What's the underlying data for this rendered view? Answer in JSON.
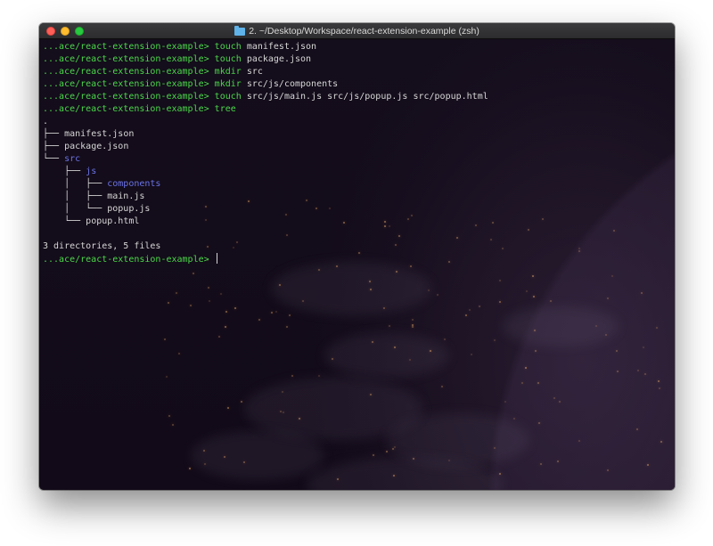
{
  "window": {
    "title": "2. ~/Desktop/Workspace/react-extension-example (zsh)",
    "title_icon": "folder-icon",
    "traffic_lights": {
      "close_color": "#fe5f57",
      "minimize_color": "#febc2e",
      "zoom_color": "#28c840"
    }
  },
  "terminal": {
    "colors": {
      "prompt": "#4bd84b",
      "directory": "#6b73e6",
      "text": "#d7d7d7"
    },
    "history": [
      {
        "prompt": "...ace/react-extension-example>",
        "command": "touch",
        "args": "manifest.json"
      },
      {
        "prompt": "...ace/react-extension-example>",
        "command": "touch",
        "args": "package.json"
      },
      {
        "prompt": "...ace/react-extension-example>",
        "command": "mkdir",
        "args": "src"
      },
      {
        "prompt": "...ace/react-extension-example>",
        "command": "mkdir",
        "args": "src/js/components"
      },
      {
        "prompt": "...ace/react-extension-example>",
        "command": "touch",
        "args": "src/js/main.js src/js/popup.js src/popup.html"
      },
      {
        "prompt": "...ace/react-extension-example>",
        "command": "tree",
        "args": ""
      }
    ],
    "tree_output": [
      {
        "branch": ".",
        "name": "",
        "is_dir": false
      },
      {
        "branch": "├── ",
        "name": "manifest.json",
        "is_dir": false
      },
      {
        "branch": "├── ",
        "name": "package.json",
        "is_dir": false
      },
      {
        "branch": "└── ",
        "name": "src",
        "is_dir": true
      },
      {
        "branch": "    ├── ",
        "name": "js",
        "is_dir": true
      },
      {
        "branch": "    │   ├── ",
        "name": "components",
        "is_dir": true
      },
      {
        "branch": "    │   ├── ",
        "name": "main.js",
        "is_dir": false
      },
      {
        "branch": "    │   └── ",
        "name": "popup.js",
        "is_dir": false
      },
      {
        "branch": "    └── ",
        "name": "popup.html",
        "is_dir": false
      }
    ],
    "summary": "3 directories, 5 files",
    "current_prompt": "...ace/react-extension-example>"
  }
}
